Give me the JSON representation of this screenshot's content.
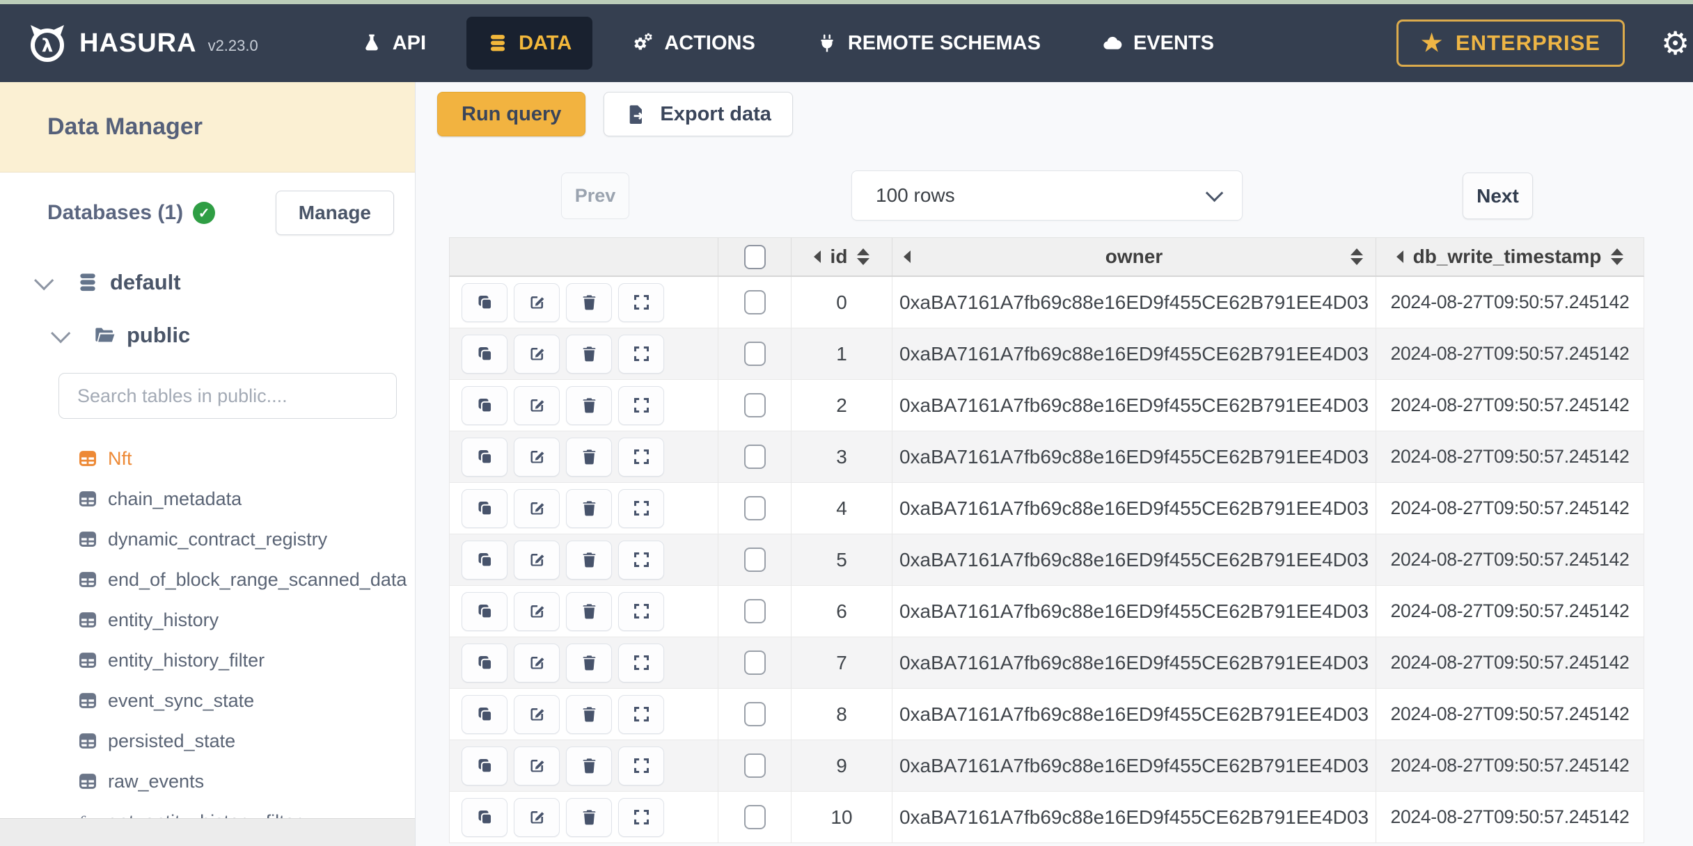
{
  "topbar": {
    "brand": "HASURA",
    "version": "v2.23.0",
    "nav": [
      {
        "label": "API",
        "icon": "flask-icon",
        "active": false
      },
      {
        "label": "DATA",
        "icon": "database-icon",
        "active": true
      },
      {
        "label": "ACTIONS",
        "icon": "gears-icon",
        "active": false
      },
      {
        "label": "REMOTE SCHEMAS",
        "icon": "plug-icon",
        "active": false
      },
      {
        "label": "EVENTS",
        "icon": "cloud-icon",
        "active": false
      }
    ],
    "enterprise_label": "ENTERPRISE"
  },
  "sidebar": {
    "title": "Data Manager",
    "databases_label": "Databases (1)",
    "manage_label": "Manage",
    "database_name": "default",
    "schema_name": "public",
    "search_placeholder": "Search tables in public....",
    "tables": [
      {
        "name": "Nft",
        "active": true
      },
      {
        "name": "chain_metadata",
        "active": false
      },
      {
        "name": "dynamic_contract_registry",
        "active": false
      },
      {
        "name": "end_of_block_range_scanned_data",
        "active": false
      },
      {
        "name": "entity_history",
        "active": false
      },
      {
        "name": "entity_history_filter",
        "active": false
      },
      {
        "name": "event_sync_state",
        "active": false
      },
      {
        "name": "persisted_state",
        "active": false
      },
      {
        "name": "raw_events",
        "active": false
      }
    ],
    "functions": [
      {
        "name": "get_entity_history_filter"
      }
    ]
  },
  "toolbar": {
    "run_query_label": "Run query",
    "export_data_label": "Export data"
  },
  "pagination": {
    "prev_label": "Prev",
    "rows_value": "100 rows",
    "next_label": "Next"
  },
  "data_table": {
    "columns": [
      "id",
      "owner",
      "db_write_timestamp"
    ],
    "rows": [
      {
        "id": "0",
        "owner": "0xaBA7161A7fb69c88e16ED9f455CE62B791EE4D03",
        "db_write_timestamp": "2024-08-27T09:50:57.245142"
      },
      {
        "id": "1",
        "owner": "0xaBA7161A7fb69c88e16ED9f455CE62B791EE4D03",
        "db_write_timestamp": "2024-08-27T09:50:57.245142"
      },
      {
        "id": "2",
        "owner": "0xaBA7161A7fb69c88e16ED9f455CE62B791EE4D03",
        "db_write_timestamp": "2024-08-27T09:50:57.245142"
      },
      {
        "id": "3",
        "owner": "0xaBA7161A7fb69c88e16ED9f455CE62B791EE4D03",
        "db_write_timestamp": "2024-08-27T09:50:57.245142"
      },
      {
        "id": "4",
        "owner": "0xaBA7161A7fb69c88e16ED9f455CE62B791EE4D03",
        "db_write_timestamp": "2024-08-27T09:50:57.245142"
      },
      {
        "id": "5",
        "owner": "0xaBA7161A7fb69c88e16ED9f455CE62B791EE4D03",
        "db_write_timestamp": "2024-08-27T09:50:57.245142"
      },
      {
        "id": "6",
        "owner": "0xaBA7161A7fb69c88e16ED9f455CE62B791EE4D03",
        "db_write_timestamp": "2024-08-27T09:50:57.245142"
      },
      {
        "id": "7",
        "owner": "0xaBA7161A7fb69c88e16ED9f455CE62B791EE4D03",
        "db_write_timestamp": "2024-08-27T09:50:57.245142"
      },
      {
        "id": "8",
        "owner": "0xaBA7161A7fb69c88e16ED9f455CE62B791EE4D03",
        "db_write_timestamp": "2024-08-27T09:50:57.245142"
      },
      {
        "id": "9",
        "owner": "0xaBA7161A7fb69c88e16ED9f455CE62B791EE4D03",
        "db_write_timestamp": "2024-08-27T09:50:57.245142"
      },
      {
        "id": "10",
        "owner": "0xaBA7161A7fb69c88e16ED9f455CE62B791EE4D03",
        "db_write_timestamp": "2024-08-27T09:50:57.245142"
      }
    ]
  },
  "colors": {
    "navbar_bg": "#353f50",
    "accent_yellow": "#f2b340",
    "brand_gold": "#eeb545",
    "active_table_orange": "#ed8936",
    "sidebar_header_cream": "#fbf0d3",
    "status_green": "#2f9e44"
  }
}
